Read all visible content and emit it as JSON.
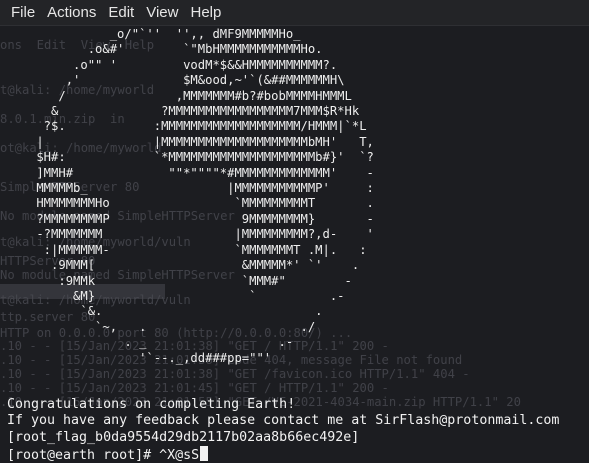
{
  "menu": [
    "File",
    "Actions",
    "Edit",
    "View",
    "Help"
  ],
  "ghost": {
    "menu": "ons  Edit  View  Help",
    "lines": [
      "t@kali: /home/myworld",
      "8.0.1.min.zip  in",
      "ot@kali: /home/myworld",
      "SimpleHTTPServer 80",
      "No module named SimpleHTTPServer",
      "t@kali: /home/myworld/vuln",
      "HTTPServer 80",
      "No module named SimpleHTTPServer",
      "t@kali: /home/myworld/vuln",
      "ttp.server 80",
      "HTTP on 0.0.0.0 port 80 (http://0.0.0.0:80/) ...",
      ".10 - - [15/Jan/2023 21:01:38] \"GET / HTTP/1.1\" 200 -",
      ".10 - - [15/Jan/2023 21:01:38] code 404, message File not found",
      ".10 - - [15/Jan/2023 21:01:38] \"GET /favicon.ico HTTP/1.1\" 404 -",
      ".10 - - [15/Jan/2023 21:01:45] \"GET / HTTP/1.1\" 200 -",
      ".10 - - [15/Jan/2023 21:01:55] \"GET /VE-2021-4034-main.zip HTTP/1.1\" 20",
      "",
      "",
      "",
      "\"GET /VE-2021-4034-main.zip HTTP/1.1\" 20"
    ]
  },
  "ascii_art": "              _o/\"`''  '',, dMF9MMMMMHo_\n           .o&#'        `\"MbHMMMMMMMMMMMHo.\n         .o\"\" '         vodM*$&&HMMMMMMMMMM?.\n        ,'              $M&ood,~'`(&##MMMMMMH\\\n       /               ,MMMMMMM#b?#bobMMMMHMMML\n      &              ?MMMMMMMMMMMMMMMMM7MMM$R*Hk\n     ?$.            :MMMMMMMMMMMMMMMMMMM/HMMM|`*L\n    |               |MMMMMMMMMMMMMMMMMMMMbMH'   T,\n    $H#:            `*MMMMMMMMMMMMMMMMMMMMb#}'  `?\n    ]MMH#             \"\"*\"\"\"\"*#MMMMMMMMMMMMM'    -\n    MMMMMb_                   |MMMMMMMMMMMP'     :\n    HMMMMMMMHo                 `MMMMMMMMMT       .\n    ?MMMMMMMMP                  9MMMMMMMM}       -\n    -?MMMMMMM                  |MMMMMMMMM?,d-    '\n     :|MMMMMM-                 `MMMMMMMT .M|.   :\n      .9MMM[                    &MMMMM*' `'    .\n       :9MMk                    `MMM#\"        -\n         &M}                     `          .-\n          `&.                             .\n            `~,   .                     ./\n                . _                  .-\n                  '`--._,dd###pp=\"\"'",
  "output": {
    "congrats": "Congratulations on completing Earth!",
    "feedback": "If you have any feedback please contact me at SirFlash@protonmail.com",
    "flag": "[root_flag_b0da9554d29db2117b02aa8b66ec492e]",
    "prompt": "[root@earth root]# ^X@sS"
  }
}
